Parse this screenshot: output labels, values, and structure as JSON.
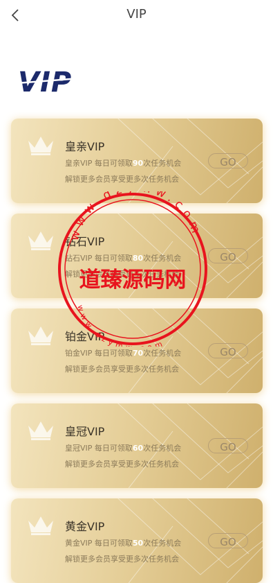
{
  "header": {
    "title": "VIP",
    "back_icon": "chevron-left-icon"
  },
  "logo": {
    "text": "VIP",
    "color": "#1c2a6b"
  },
  "cards": [
    {
      "title": "皇亲VIP",
      "desc_prefix": "皇亲VIP 每日可领取",
      "count": "90",
      "desc_suffix": "次任务机会",
      "sub": "解锁更多会员享受更多次任务机会",
      "button": "GO"
    },
    {
      "title": "钻石VIP",
      "desc_prefix": "钻石VIP 每日可领取",
      "count": "80",
      "desc_suffix": "次任务机会",
      "sub": "解锁更多会员享受更多次任务机会",
      "button": "GO"
    },
    {
      "title": "铂金VIP",
      "desc_prefix": "铂金VIP 每日可领取",
      "count": "70",
      "desc_suffix": "次任务机会",
      "sub": "解锁更多会员享受更多次任务机会",
      "button": "GO"
    },
    {
      "title": "皇冠VIP",
      "desc_prefix": "皇冠VIP 每日可领取",
      "count": "60",
      "desc_suffix": "次任务机会",
      "sub": "解锁更多会员享受更多次任务机会",
      "button": "GO"
    },
    {
      "title": "黄金VIP",
      "desc_prefix": "黄金VIP 每日可领取",
      "count": "50",
      "desc_suffix": "次任务机会",
      "sub": "解锁更多会员享受更多次任务机会",
      "button": "GO"
    }
  ],
  "watermark": {
    "center_text": "道臻源码网",
    "ring_text": "www.dzymw.com",
    "color": "#e8141e"
  },
  "colors": {
    "card_gold": "#e4cd96",
    "number_highlight": "#ffffff"
  }
}
